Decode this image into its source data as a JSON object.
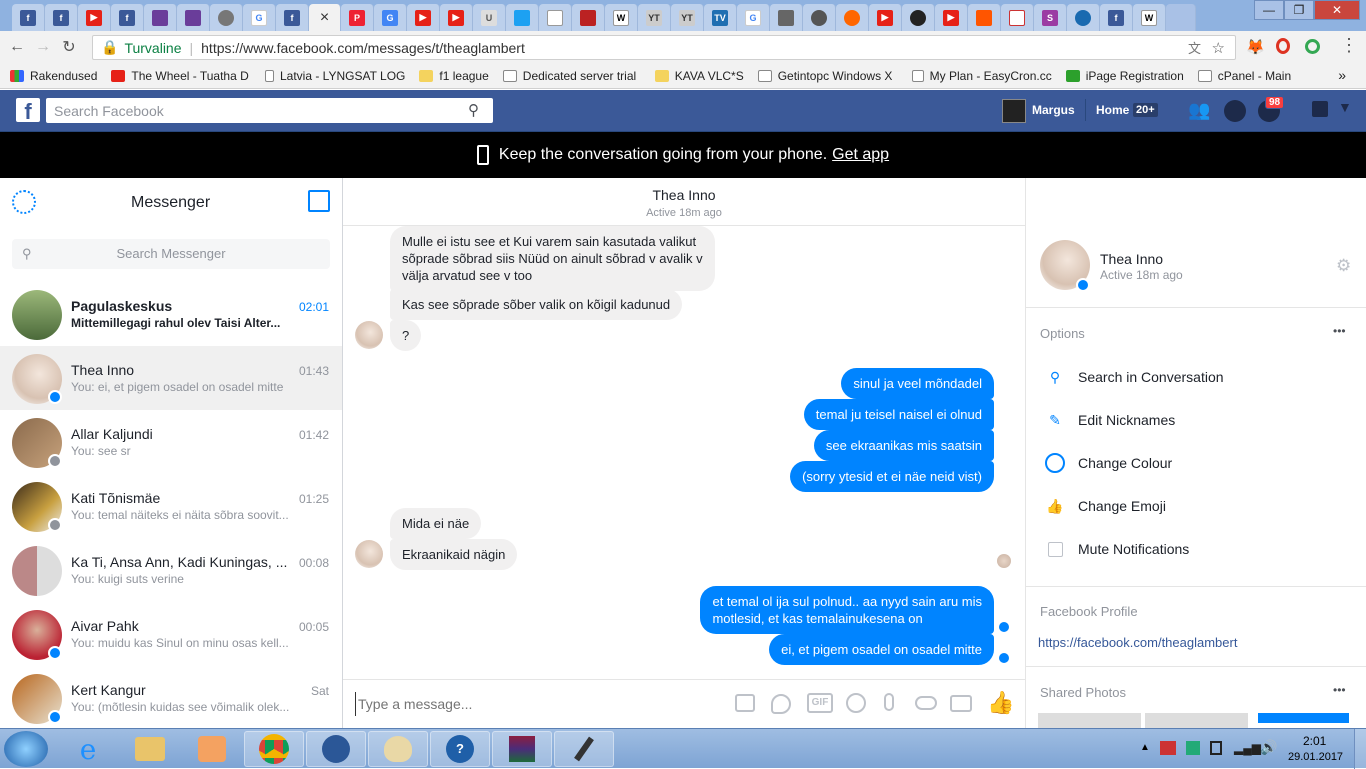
{
  "browser": {
    "active_tab_close": "×",
    "url_secure_label": "Turvaline",
    "url": "https://www.facebook.com/messages/t/theaglambert",
    "bookmarks_label": "Rakendused",
    "bookmarks": [
      "The Wheel - Tuatha D",
      "Latvia - LYNGSAT LOG",
      "f1 league",
      "Dedicated server trial",
      "KAVA VLC*S",
      "Getintopc Windows X",
      "My Plan - EasyCron.cc",
      "iPage Registration",
      "cPanel - Main"
    ],
    "more": "»"
  },
  "fb": {
    "search_placeholder": "Search Facebook",
    "user": "Margus",
    "home": "Home",
    "home_count": "20+",
    "notif_count": "98",
    "promo_text": "Keep the conversation going from your phone.",
    "promo_link": "Get app"
  },
  "messenger": {
    "title": "Messenger",
    "search_placeholder": "Search Messenger",
    "conversations": [
      {
        "name": "Pagulaskeskus",
        "time": "02:01",
        "snippet": "Mittemillegagi rahul olev Taisi Alter...",
        "unread": true
      },
      {
        "name": "Thea Inno",
        "time": "01:43",
        "snippet": "You: ei, et pigem osadel on osadel mitte"
      },
      {
        "name": "Allar Kaljundi",
        "time": "01:42",
        "snippet": "You: see sr"
      },
      {
        "name": "Kati Tõnismäe",
        "time": "01:25",
        "snippet": "You: temal näiteks ei näita sõbra soovit..."
      },
      {
        "name": "Ka Ti, Ansa Ann, Kadi Kuningas, ...",
        "time": "00:08",
        "snippet": "You: kuigi suts verine"
      },
      {
        "name": "Aivar Pahk",
        "time": "00:05",
        "snippet": "You: muidu kas Sinul on minu osas kell..."
      },
      {
        "name": "Kert Kangur",
        "time": "Sat",
        "snippet": "You: (mõtlesin kuidas see võimalik olek..."
      }
    ]
  },
  "chat": {
    "name": "Thea Inno",
    "status": "Active 18m ago",
    "messages": [
      {
        "dir": "in",
        "lines": [
          "Mulle ei istu see et Kui varem sain kasutada valikut",
          "sõprade sõbrad siis Nüüd on ainult sõbrad v avalik v",
          "välja arvatud see v too"
        ]
      },
      {
        "dir": "in",
        "lines": [
          "Kas see sõprade sõber valik on kõigil kadunud"
        ]
      },
      {
        "dir": "in",
        "lines": [
          "?"
        ]
      },
      {
        "dir": "out",
        "lines": [
          "sinul ja veel mõndadel"
        ]
      },
      {
        "dir": "out",
        "lines": [
          "temal ju teisel naisel ei olnud"
        ]
      },
      {
        "dir": "out",
        "lines": [
          "see ekraanikas mis saatsin"
        ]
      },
      {
        "dir": "out",
        "lines": [
          "(sorry ytesid et ei näe neid vist)"
        ]
      },
      {
        "dir": "in",
        "lines": [
          "Mida ei näe"
        ]
      },
      {
        "dir": "in",
        "lines": [
          "Ekraanikaid nägin"
        ]
      },
      {
        "dir": "out",
        "lines": [
          "et temal ol ija sul polnud.. aa nyyd sain aru mis",
          "motlesid, et kas temalainukesena on"
        ]
      },
      {
        "dir": "out",
        "lines": [
          "ei,  et pigem osadel on osadel mitte"
        ]
      }
    ],
    "composer_placeholder": "Type a message..."
  },
  "info": {
    "name": "Thea Inno",
    "status": "Active 18m ago",
    "options_label": "Options",
    "options": [
      "Search in Conversation",
      "Edit Nicknames",
      "Change Colour",
      "Change Emoji",
      "Mute Notifications"
    ],
    "profile_label": "Facebook Profile",
    "profile_url": "https://facebook.com/theaglambert",
    "photos_label": "Shared Photos",
    "more": "•••"
  },
  "taskbar": {
    "time": "2:01",
    "date": "29.01.2017"
  },
  "colors": {
    "fb_blue": "#3b5998",
    "messenger_blue": "#0084ff"
  }
}
